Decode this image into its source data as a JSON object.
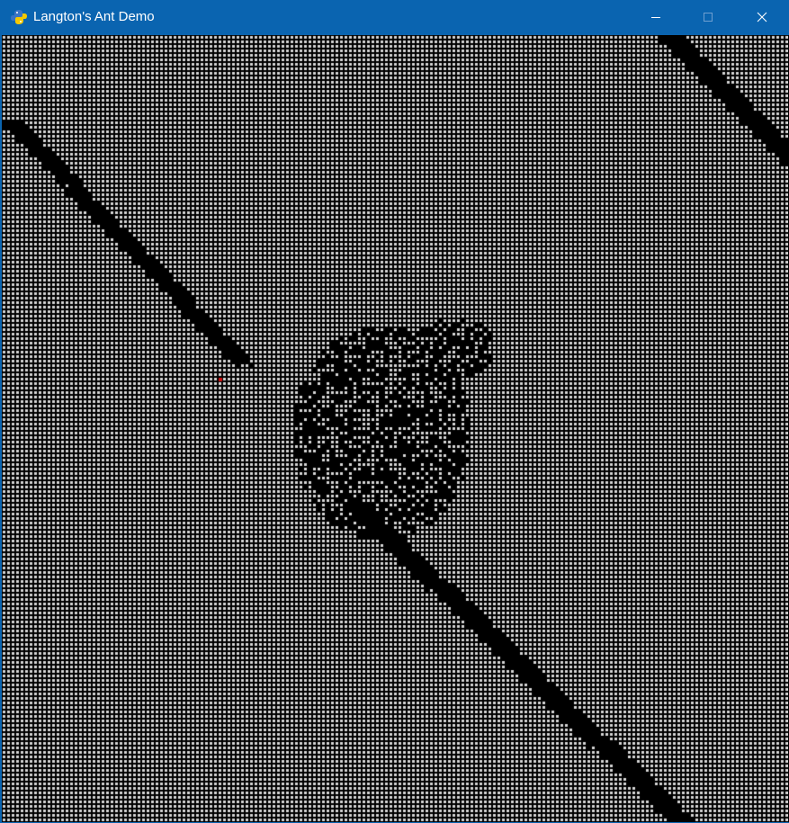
{
  "window": {
    "title": "Langton's Ant Demo",
    "titlebar_color": "#0a64b0",
    "app_icon": "pygame-snake-icon",
    "controls": {
      "minimize_icon": "minimize-icon",
      "maximize_icon": "maximize-icon",
      "close_icon": "close-icon"
    }
  },
  "simulation": {
    "grid_columns": 175,
    "grid_rows": 175,
    "colors": {
      "white_cell": "#d6d6d6",
      "black_cell": "#000000",
      "ant": "#d01010"
    },
    "ant_cell": [
      48,
      76
    ]
  }
}
